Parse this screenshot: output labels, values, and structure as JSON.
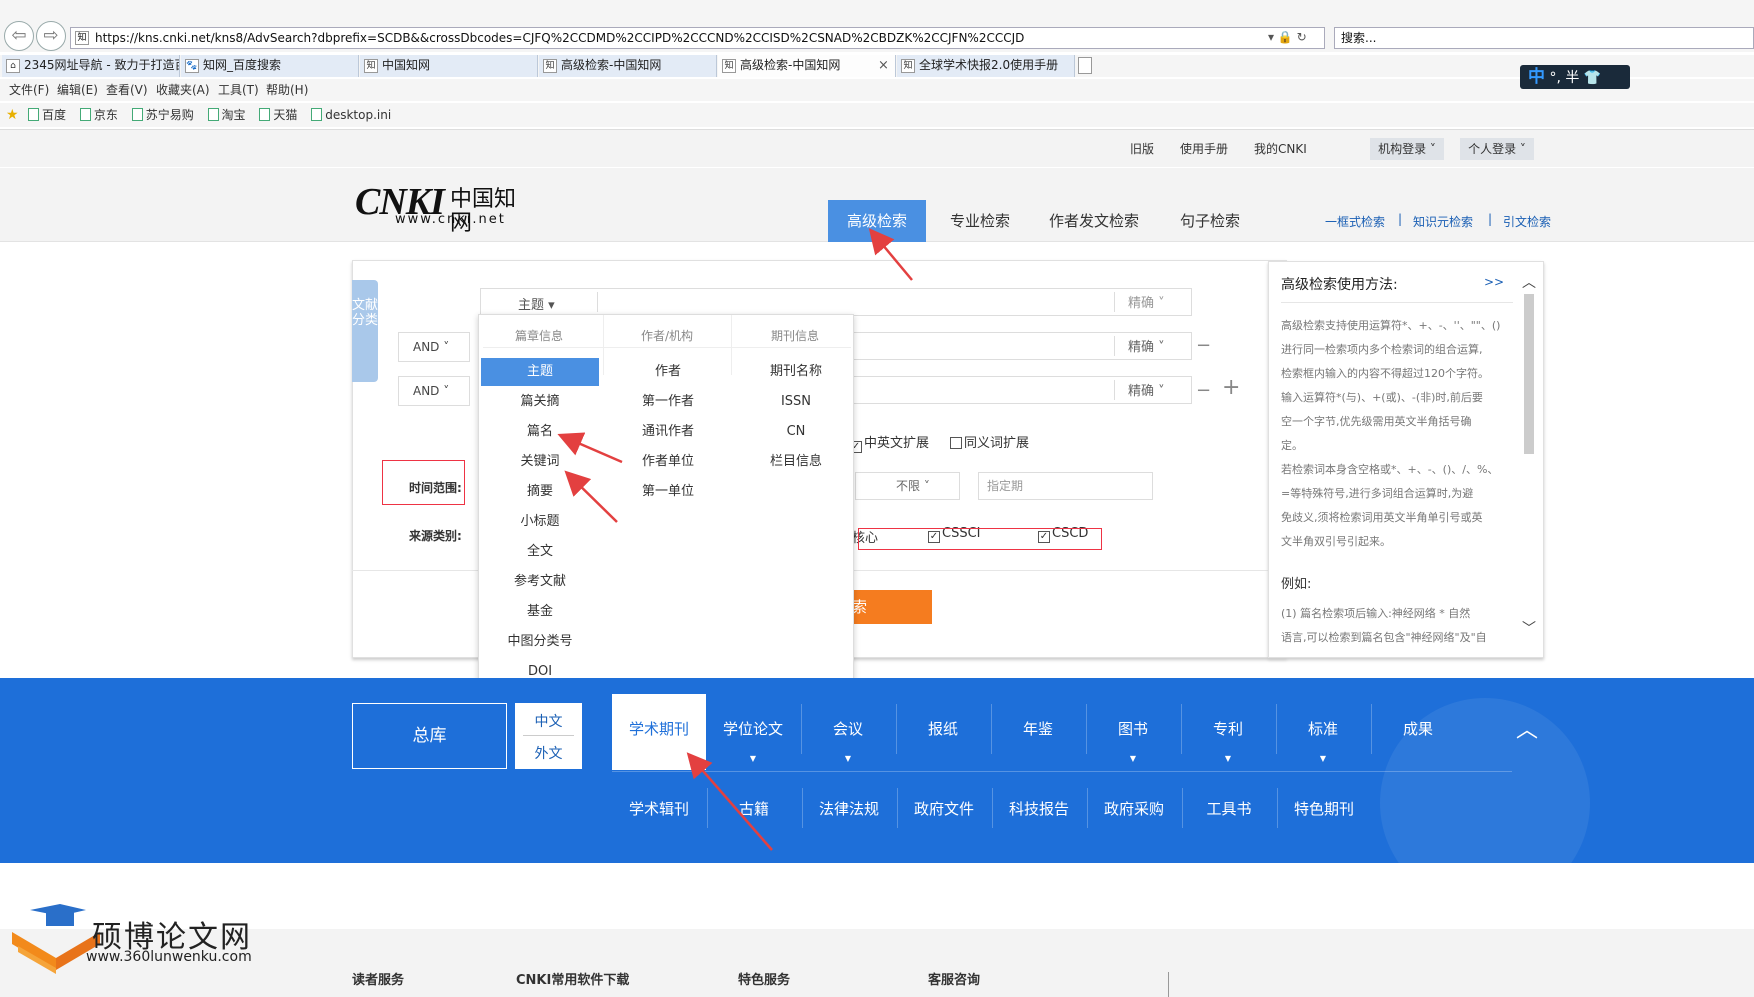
{
  "browser": {
    "url": "https://kns.cnki.net/kns8/AdvSearch?dbprefix=SCDB&&crossDbcodes=CJFQ%2CCDMD%2CCIPD%2CCCND%2CCISD%2CSNAD%2CBDZK%2CCJFN%2CCCJD",
    "search_placeholder": "搜索...",
    "back_glyph": "⇦",
    "forward_glyph": "⇨",
    "addr_icons": "▾ 🔒 ↻",
    "tabs": [
      {
        "label": "2345网址导航 - 致力于打造百...",
        "icon": "⌂"
      },
      {
        "label": "知网_百度搜索",
        "icon": "🐾"
      },
      {
        "label": "中国知网",
        "icon": "知"
      },
      {
        "label": "高级检索-中国知网",
        "icon": "知"
      },
      {
        "label": "高级检索-中国知网",
        "icon": "知",
        "close": "×"
      },
      {
        "label": "全球学术快报2.0使用手册",
        "icon": "知"
      }
    ],
    "menu": [
      "文件(F)",
      "编辑(E)",
      "查看(V)",
      "收藏夹(A)",
      "工具(T)",
      "帮助(H)"
    ],
    "favorites": [
      "百度",
      "京东",
      "苏宁易购",
      "淘宝",
      "天猫",
      "desktop.ini"
    ],
    "ime": {
      "lang": "中",
      "rest": "°, 半 👕"
    }
  },
  "top": {
    "links": [
      "旧版",
      "使用手册",
      "我的CNKI"
    ],
    "institution_login": "机构登录 ˅",
    "personal_login": "个人登录 ˅"
  },
  "logo": {
    "cnki": "CNKI",
    "zh": "中国知网",
    "url": "www.cnki.net"
  },
  "nav": {
    "tabs": [
      "高级检索",
      "专业检索",
      "作者发文检索",
      "句子检索"
    ],
    "right_links": [
      "一框式检索",
      "知识元检索",
      "引文检索"
    ],
    "sep": "|"
  },
  "search": {
    "side_tab": "文献分类",
    "field_select": "主题 ▾",
    "and1": "AND ˅",
    "and2": "AND ˅",
    "exact": "精确 ˅",
    "minus": "−",
    "plus": "+",
    "time_label": "时间范围:",
    "source_label": "来源类别:",
    "zh_en_ext": "中英文扩展",
    "synonym_ext": "同义词扩展",
    "unlimited": "不限 ˅",
    "specified": "指定期",
    "core": "核心",
    "cssci": "CSSCI",
    "cscd": "CSCD",
    "search_btn": "检索",
    "search_btn_visible": "索"
  },
  "dropdown": {
    "col1_header": "篇章信息",
    "col2_header": "作者/机构",
    "col3_header": "期刊信息",
    "col1": [
      "主题",
      "篇关摘",
      "篇名",
      "关键词",
      "摘要",
      "小标题",
      "全文",
      "参考文献",
      "基金",
      "中图分类号",
      "DOI"
    ],
    "col2": [
      "作者",
      "第一作者",
      "通讯作者",
      "作者单位",
      "第一单位"
    ],
    "col3": [
      "期刊名称",
      "ISSN",
      "CN",
      "栏目信息"
    ],
    "selected": "主题"
  },
  "help": {
    "title": "高级检索使用方法:",
    "more": ">>",
    "lines": [
      "高级检索支持使用运算符*、+、-、''、\"\"、()",
      "进行同一检索项内多个检索词的组合运算,",
      "检索框内输入的内容不得超过120个字符。",
      "输入运算符*(与)、+(或)、-(非)时,前后要",
      "空一个字节,优先级需用英文半角括号确",
      "定。",
      "若检索词本身含空格或*、+、-、()、/、%、",
      "=等特殊符号,进行多词组合运算时,为避",
      "免歧义,须将检索词用英文半角单引号或英",
      "文半角双引号引起来。"
    ],
    "example_title": "例如:",
    "example_lines": [
      "(1) 篇名检索项后输入:神经网络 * 自然",
      "语言,可以检索到篇名包含\"神经网络\"及\"自"
    ],
    "scroll_up": "︿",
    "scroll_down": "﹀"
  },
  "databases": {
    "all": "总库",
    "zh": "中文",
    "foreign": "外文",
    "row1": [
      "学术期刊",
      "学位论文",
      "会议",
      "报纸",
      "年鉴",
      "图书",
      "专利",
      "标准",
      "成果"
    ],
    "row2": [
      "学术辑刊",
      "古籍",
      "法律法规",
      "政府文件",
      "科技报告",
      "政府采购",
      "工具书",
      "特色期刊"
    ],
    "caret": "▼",
    "collapse": "︿"
  },
  "footer": {
    "titles": [
      "读者服务",
      "CNKI常用软件下载",
      "特色服务",
      "客服咨询"
    ]
  },
  "watermark": {
    "name": "硕博论文网",
    "url": "www.360lunwenku.com"
  },
  "colors": {
    "accent": "#4a90e2",
    "band": "#1e6fd9",
    "search_btn": "#f57c1f",
    "annotation": "#e34040"
  }
}
